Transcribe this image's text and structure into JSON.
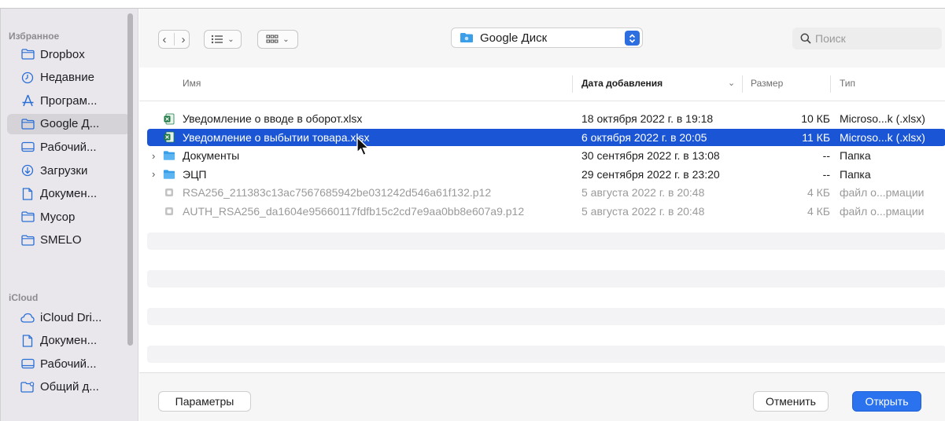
{
  "sidebar": {
    "favorites_title": "Избранное",
    "icloud_title": "iCloud",
    "favorites": [
      {
        "label": "Dropbox",
        "icon": "folder-icon"
      },
      {
        "label": "Недавние",
        "icon": "clock-icon"
      },
      {
        "label": "Програм...",
        "icon": "apps-icon"
      },
      {
        "label": "Google Д...",
        "icon": "folder-icon",
        "selected": true
      },
      {
        "label": "Рабочий...",
        "icon": "desktop-icon"
      },
      {
        "label": "Загрузки",
        "icon": "download-icon"
      },
      {
        "label": "Докумен...",
        "icon": "document-icon"
      },
      {
        "label": "Мусор",
        "icon": "folder-icon"
      },
      {
        "label": "SMELO",
        "icon": "folder-icon"
      }
    ],
    "icloud": [
      {
        "label": "iCloud Dri...",
        "icon": "cloud-icon"
      },
      {
        "label": "Докумен...",
        "icon": "document-icon"
      },
      {
        "label": "Рабочий...",
        "icon": "desktop-icon"
      },
      {
        "label": "Общий д...",
        "icon": "shared-folder-icon"
      }
    ]
  },
  "toolbar": {
    "location": "Google Диск",
    "search_placeholder": "Поиск"
  },
  "columns": {
    "name": "Имя",
    "date": "Дата добавления",
    "size": "Размер",
    "type": "Тип"
  },
  "files": [
    {
      "name": "Уведомление о вводе в оборот.xlsx",
      "date": "18 октября 2022 г. в 19:18",
      "size": "10 КБ",
      "type": "Microso...k (.xlsx)",
      "icon": "excel-file-icon"
    },
    {
      "name": "Уведомление о выбытии товара.xlsx",
      "date": "6 октября 2022 г. в 20:05",
      "size": "11 КБ",
      "type": "Microso...k (.xlsx)",
      "icon": "excel-file-icon",
      "selected": true
    },
    {
      "name": "Документы",
      "date": "30 сентября 2022 г. в 13:08",
      "size": "--",
      "type": "Папка",
      "icon": "folder-icon",
      "expandable": true
    },
    {
      "name": "ЭЦП",
      "date": "29 сентября 2022 г. в 23:20",
      "size": "--",
      "type": "Папка",
      "icon": "folder-icon",
      "expandable": true
    },
    {
      "name": "RSA256_211383c13ac7567685942be031242d546a61f132.p12",
      "date": "5 августа 2022 г. в 20:48",
      "size": "4 КБ",
      "type": "файл о...рмации",
      "icon": "certificate-file-icon",
      "dim": true
    },
    {
      "name": "AUTH_RSA256_da1604e95660117fdfb15c2cd7e9aa0bb8e607a9.p12",
      "date": "5 августа 2022 г. в 20:48",
      "size": "4 КБ",
      "type": "файл о...рмации",
      "icon": "certificate-file-icon",
      "dim": true
    }
  ],
  "buttons": {
    "params": "Параметры",
    "cancel": "Отменить",
    "open": "Открыть"
  },
  "colors": {
    "accent": "#1a55d5",
    "sidebar_bg": "#e9e7ec",
    "folder_blue": "#3a9ee8",
    "excel_green": "#1e7a45"
  }
}
